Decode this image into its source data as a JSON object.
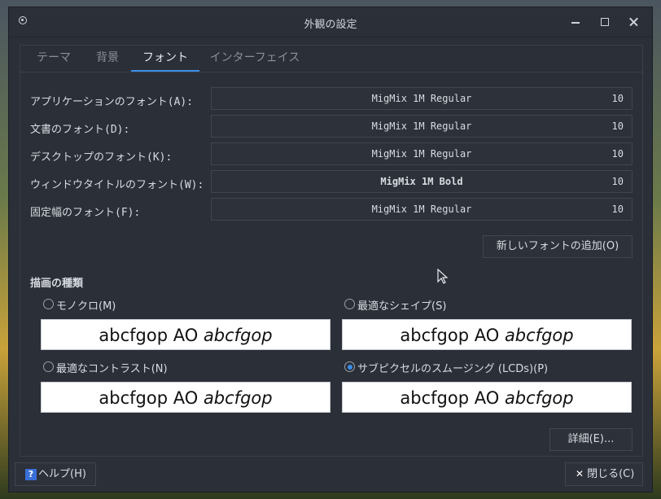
{
  "window": {
    "title": "外観の設定"
  },
  "tabs": [
    {
      "label": "テーマ"
    },
    {
      "label": "背景"
    },
    {
      "label": "フォント"
    },
    {
      "label": "インターフェイス"
    }
  ],
  "fonts": [
    {
      "label": "アプリケーションのフォント(A):",
      "name": "MigMix 1M Regular",
      "size": "10"
    },
    {
      "label": "文書のフォント(D):",
      "name": "MigMix 1M Regular",
      "size": "10"
    },
    {
      "label": "デスクトップのフォント(K):",
      "name": "MigMix 1M Regular",
      "size": "10"
    },
    {
      "label": "ウィンドウタイトルのフォント(W):",
      "name": "MigMix 1M Bold",
      "size": "10"
    },
    {
      "label": "固定幅のフォント(F):",
      "name": "MigMix 1M Regular",
      "size": "10"
    }
  ],
  "add_font_label": "新しいフォントの追加(O)",
  "rendering": {
    "title": "描画の種類",
    "options": [
      {
        "label": "モノクロ(M)",
        "checked": false
      },
      {
        "label": "最適なシェイプ(S)",
        "checked": false
      },
      {
        "label": "最適なコントラスト(N)",
        "checked": false
      },
      {
        "label": "サブピクセルのスムージング (LCDs)(P)",
        "checked": true
      }
    ],
    "preview_plain": "abcfgop AO ",
    "preview_italic": "abcfgop"
  },
  "details_label": "詳細(E)...",
  "help_label": "ヘルプ(H)",
  "close_label": "閉じる(C)",
  "colors": {
    "accent": "#3d8ee9",
    "window_bg": "#2b2f37",
    "button_bg": "#2d3139"
  },
  "icons": {
    "help": "question-icon",
    "close": "x-icon"
  }
}
